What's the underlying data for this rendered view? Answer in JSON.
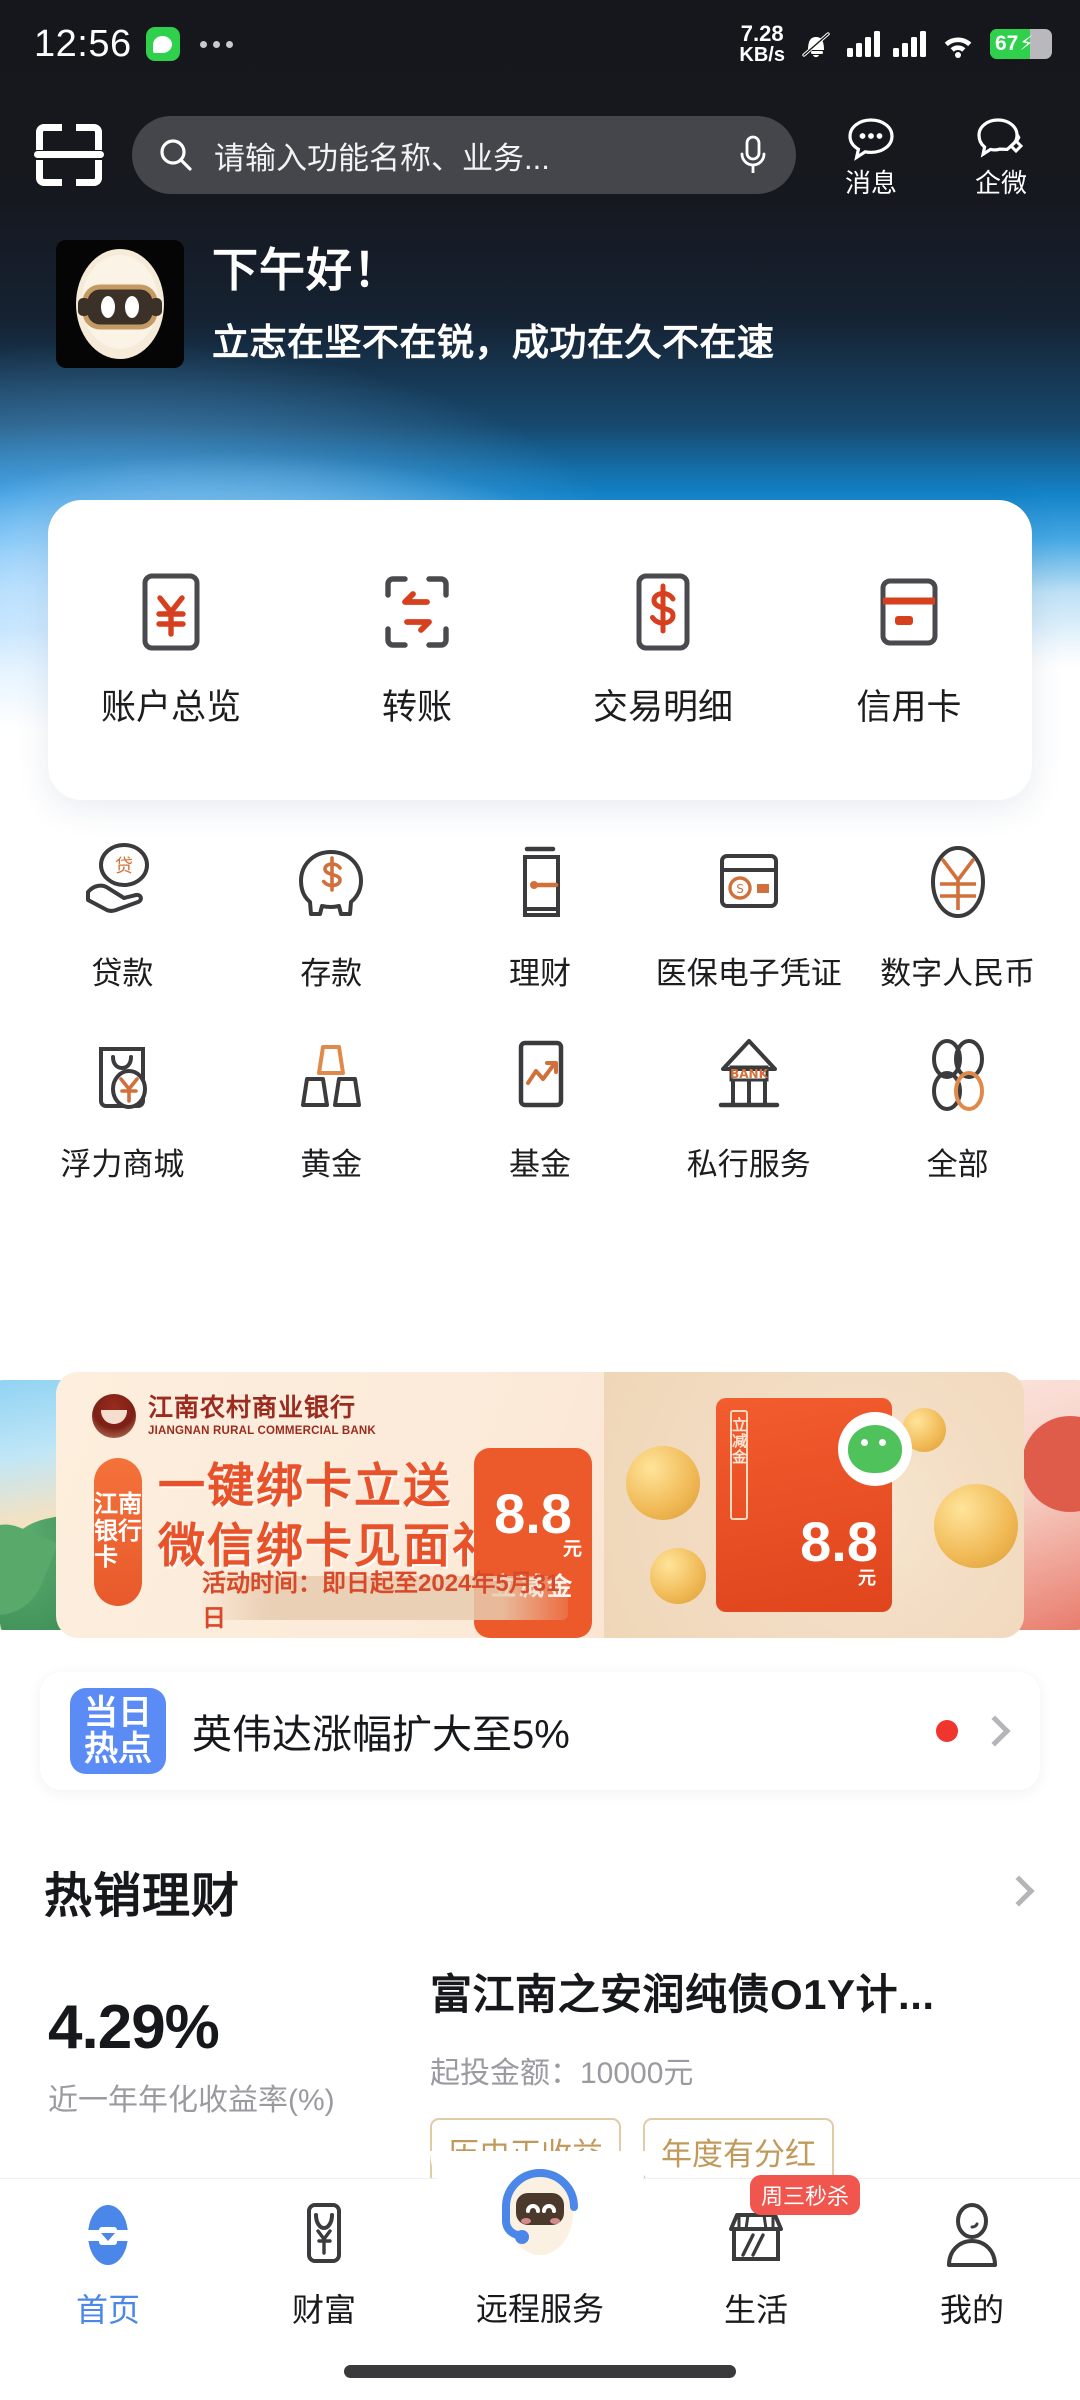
{
  "status_bar": {
    "time": "12:56",
    "app_badge_icon": "message-bubble-icon",
    "overflow_icon": "more-dots-icon",
    "net_speed_value": "7.28",
    "net_speed_unit": "KB/s",
    "mute_icon": "bell-muted-icon",
    "signal_icon_1": "signal-bars-icon",
    "signal_icon_2": "signal-bars-icon",
    "wifi_icon": "wifi-icon",
    "battery_percent": "67",
    "battery_charging_icon": "lightning-bolt-icon"
  },
  "header": {
    "scan_icon": "scan-qr-icon",
    "search": {
      "icon": "search-icon",
      "placeholder": "请输入功能名称、业务...",
      "mic_icon": "microphone-icon"
    },
    "actions": [
      {
        "icon": "chat-bubble-icon",
        "label": "消息"
      },
      {
        "icon": "wecom-icon",
        "label": "企微"
      }
    ]
  },
  "greeting": {
    "avatar_icon": "robot-avatar",
    "title": "下午好！",
    "subtitle": "立志在坚不在锐，成功在久不在速"
  },
  "quick_actions": [
    {
      "icon": "yuan-card-icon",
      "label": "账户总览"
    },
    {
      "icon": "transfer-scan-icon",
      "label": "转账"
    },
    {
      "icon": "dollar-card-icon",
      "label": "交易明细"
    },
    {
      "icon": "credit-card-icon",
      "label": "信用卡"
    }
  ],
  "service_grid": [
    [
      {
        "icon": "loan-hand-icon",
        "label": "贷款"
      },
      {
        "icon": "piggy-bank-icon",
        "label": "存款"
      },
      {
        "icon": "wealth-door-icon",
        "label": "理财"
      },
      {
        "icon": "medical-insurance-card-icon",
        "label": "医保电子凭证"
      },
      {
        "icon": "digital-rmb-icon",
        "label": "数字人民币"
      }
    ],
    [
      {
        "icon": "shopping-bag-yuan-icon",
        "label": "浮力商城"
      },
      {
        "icon": "gold-bars-icon",
        "label": "黄金"
      },
      {
        "icon": "fund-chart-icon",
        "label": "基金"
      },
      {
        "icon": "bank-building-icon",
        "label": "私行服务"
      },
      {
        "icon": "all-clover-icon",
        "label": "全部"
      }
    ]
  ],
  "banner": {
    "bank_name_cn": "江南农村商业银行",
    "bank_name_en": "JIANGNAN RURAL COMMERCIAL BANK",
    "vertical_pill": "江南银行卡",
    "headline_line1": "一键绑卡立送",
    "headline_line2": "微信绑卡见面礼",
    "amount": "8.8",
    "amount_unit": "元",
    "amount_sub": "立减金",
    "art_vertical_label": "立减金",
    "art_amount": "8.8",
    "art_amount_unit": "元",
    "date_text": "活动时间：即日起至2024年5月31日"
  },
  "news": {
    "badge": "当日热点",
    "text": "英伟达涨幅扩大至5%",
    "dot_color": "#f0342e",
    "chevron_icon": "chevron-right-icon"
  },
  "wealth_section": {
    "title": "热销理财",
    "more_icon": "chevron-right-icon",
    "product": {
      "rate": "4.29%",
      "rate_label": "近一年年化收益率(%)",
      "name": "富江南之安润纯债O1Y计...",
      "min_invest": "起投金额：10000元",
      "tags": [
        "历史正收益",
        "年度有分红"
      ]
    }
  },
  "bottom_nav": {
    "items": [
      {
        "icon": "home-icon",
        "label": "首页",
        "active": true,
        "badge": ""
      },
      {
        "icon": "wealth-phone-icon",
        "label": "财富",
        "active": false,
        "badge": ""
      },
      {
        "icon": "remote-service-robot-icon",
        "label": "远程服务",
        "active": false,
        "badge": ""
      },
      {
        "icon": "life-store-icon",
        "label": "生活",
        "active": false,
        "badge": "周三秒杀"
      },
      {
        "icon": "profile-person-icon",
        "label": "我的",
        "active": false,
        "badge": ""
      }
    ],
    "active_color": "#4a87e8"
  }
}
